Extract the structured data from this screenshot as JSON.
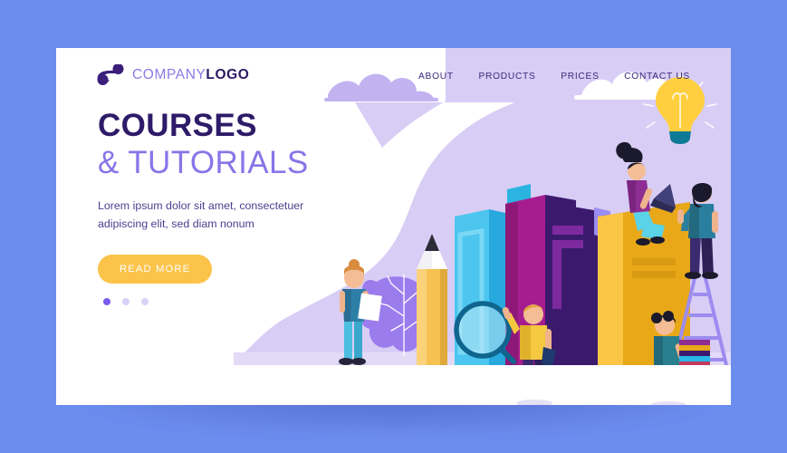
{
  "page": {
    "background_color": "#6c8cee",
    "card_color": "#ffffff",
    "illustration_band_color": "#d8cdf5"
  },
  "header": {
    "logo": {
      "icon": "swoosh-logo-mark",
      "text_light": "COMPANY",
      "text_bold": "LOGO",
      "light_color": "#8c7ae6",
      "bold_color": "#2b1a64"
    },
    "nav": [
      {
        "label": "ABOUT"
      },
      {
        "label": "PRODUCTS"
      },
      {
        "label": "PRICES"
      },
      {
        "label": "CONTACT US"
      }
    ]
  },
  "hero": {
    "title_line1": "COURSES",
    "title_line2": "& TUTORIALS",
    "title_line1_color": "#2d1b69",
    "title_line2_color": "#8875e8",
    "paragraph": "Lorem ipsum dolor sit amet, consectetuer adipiscing elit, sed diam nonum",
    "cta_label": "READ MORE",
    "cta_color": "#fbc34a",
    "carousel": {
      "count": 3,
      "active_index": 0,
      "active_color": "#7c5cf0",
      "inactive_color": "#d9d2f7"
    }
  },
  "illustration": {
    "name": "education-books-scene",
    "elements": [
      {
        "name": "cloud-left",
        "color": "#c3b2f0"
      },
      {
        "name": "cloud-right",
        "color": "#ffffff"
      },
      {
        "name": "lightbulb-icon",
        "color": "#ffcf3f"
      },
      {
        "name": "pencil",
        "color": "#f5c252"
      },
      {
        "name": "book-cyan",
        "color": "#29b6e8"
      },
      {
        "name": "book-magenta",
        "color": "#a61d8f"
      },
      {
        "name": "book-dark-purple",
        "color": "#3b1a6e"
      },
      {
        "name": "book-yellow",
        "color": "#e8a818"
      },
      {
        "name": "magnifier-icon",
        "color": "#10658f"
      },
      {
        "name": "tree-shrub",
        "color": "#9b7ced"
      },
      {
        "name": "ladder",
        "color": "#9c8cf0"
      },
      {
        "name": "person-girl-with-paper"
      },
      {
        "name": "person-boy-with-magnifier"
      },
      {
        "name": "person-girl-with-laptop"
      },
      {
        "name": "person-boy-with-book-stack"
      },
      {
        "name": "person-man-on-ladder"
      }
    ]
  }
}
